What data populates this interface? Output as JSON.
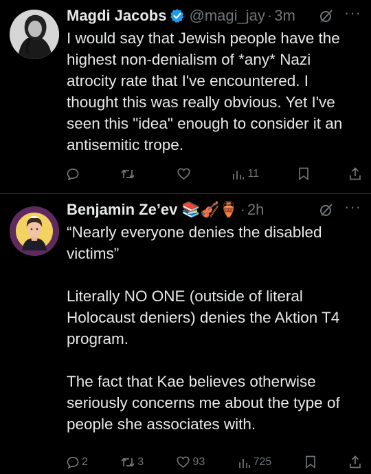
{
  "tweets": [
    {
      "author_name": "Magdi Jacobs",
      "handle": "@magi_jay",
      "separator": "·",
      "time": "3m",
      "more": "···",
      "text": [
        "I would say that Jewish people have the highest non-denialism of *any* Nazi atrocity rate that I've encountered. I thought this was really obvious. Yet I've seen this \"idea\" enough to consider it an antisemitic trope."
      ],
      "actions": {
        "replies": "",
        "reposts": "",
        "likes": "",
        "views": "11"
      },
      "verified": true
    },
    {
      "author_name": "Benjamin Ze’ev",
      "handle": "",
      "separator": "·",
      "time": "2h",
      "more": "···",
      "emoji": "📚🎻🏺",
      "text": [
        "“Nearly everyone denies the disabled victims”",
        "Literally NO ONE (outside of literal Holocaust deniers) denies the Aktion T4 program.",
        "The fact that Kae believes otherwise seriously concerns me about the type of people she associates with."
      ],
      "actions": {
        "replies": "2",
        "reposts": "3",
        "likes": "93",
        "views": "725"
      },
      "verified": false
    }
  ],
  "colors": {
    "background": "#000000",
    "text": "#e7e9ea",
    "muted": "#71767b",
    "verified": "#1d9bf0",
    "divider": "#2f3336"
  }
}
